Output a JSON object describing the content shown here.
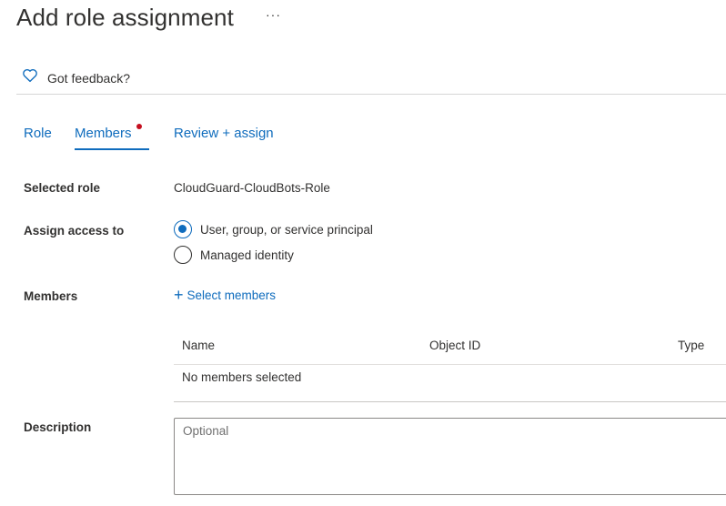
{
  "header": {
    "title": "Add role assignment",
    "more": "···"
  },
  "feedback": {
    "label": "Got feedback?",
    "icon": "heart-icon"
  },
  "tabs": [
    {
      "label": "Role"
    },
    {
      "label": "Members",
      "selected": true,
      "has_indicator": true
    },
    {
      "label": "Review + assign"
    }
  ],
  "form": {
    "selected_role": {
      "label": "Selected role",
      "value": "CloudGuard-CloudBots-Role"
    },
    "assign_access": {
      "label": "Assign access to",
      "options": [
        {
          "label": "User, group, or service principal",
          "checked": true
        },
        {
          "label": "Managed identity",
          "checked": false
        }
      ]
    },
    "members": {
      "label": "Members",
      "select_label": "Select members",
      "table": {
        "columns": [
          "Name",
          "Object ID",
          "Type"
        ],
        "empty_text": "No members selected"
      }
    },
    "description": {
      "label": "Description",
      "placeholder": "Optional"
    }
  },
  "colors": {
    "accent": "#0f6cbd",
    "indicator": "#c50f1f",
    "text": "#323130"
  }
}
